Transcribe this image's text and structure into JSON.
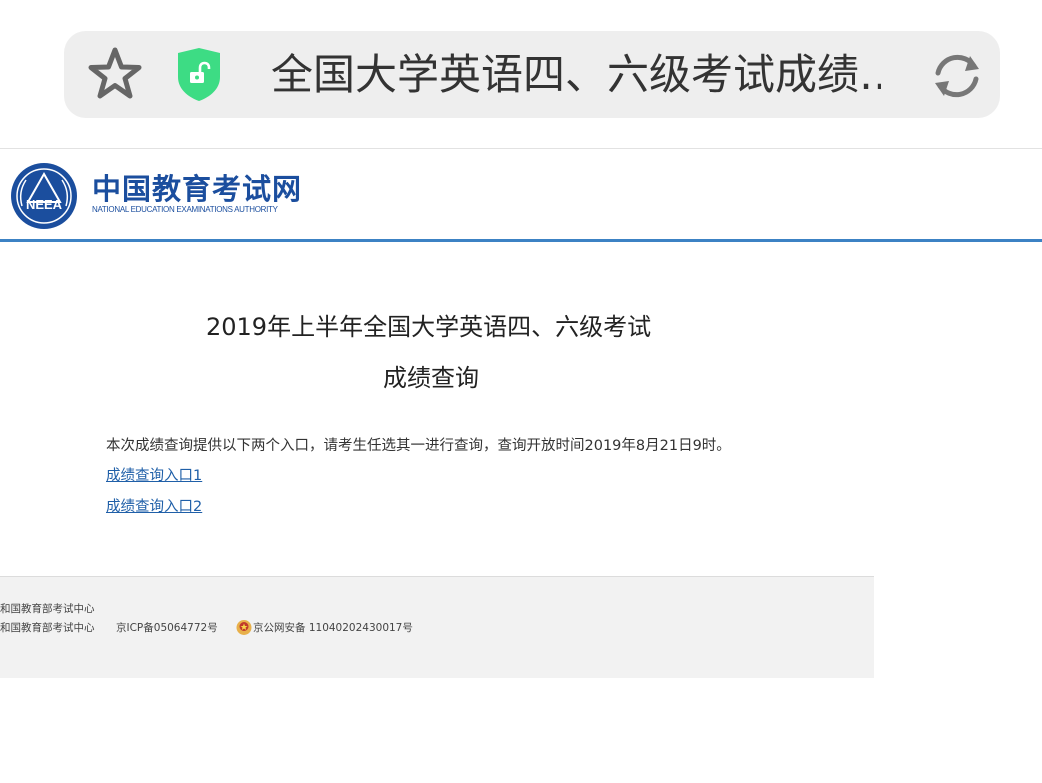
{
  "browser": {
    "address_title": "全国大学英语四、六级考试成绩…",
    "icons": [
      "star-icon",
      "lock-open-shield-icon",
      "refresh-icon"
    ],
    "shield_color": "#3ddc84"
  },
  "site": {
    "name": "中国教育考试网",
    "name_en": "NATIONAL EDUCATION EXAMINATIONS AUTHORITY",
    "logo_text": "NEEA",
    "brand_color": "#1b4e9e",
    "header_line_color": "#3c82c4"
  },
  "main": {
    "title_line1": "2019年上半年全国大学英语四、六级考试",
    "title_line2": "成绩查询",
    "notice": "本次成绩查询提供以下两个入口，请考生任选其一进行查询，查询开放时间2019年8月21日9时。",
    "entries": [
      {
        "label": "成绩查询入口1"
      },
      {
        "label": "成绩查询入口2"
      }
    ]
  },
  "footer": {
    "line1": "和国教育部考试中心",
    "line2": "和国教育部考试中心",
    "icp": "京ICP备05064772号",
    "police": "京公网安备 11040202430017号"
  }
}
